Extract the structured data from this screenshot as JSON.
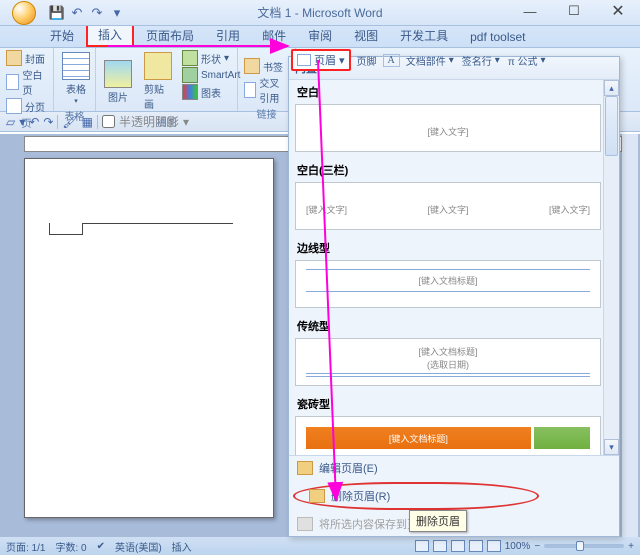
{
  "title": "文档 1 - Microsoft Word",
  "tabs": [
    "开始",
    "插入",
    "页面布局",
    "引用",
    "邮件",
    "审阅",
    "视图",
    "开发工具",
    "pdf toolset"
  ],
  "active_tab_index": 1,
  "ribbon": {
    "groups": [
      {
        "label": "页",
        "items": [
          "封面",
          "空白页",
          "分页"
        ]
      },
      {
        "label": "表格",
        "items": [
          "表格"
        ]
      },
      {
        "label": "插图",
        "items": [
          "图片",
          "剪贴画"
        ],
        "mini": [
          "形状",
          "SmartArt",
          "图表"
        ]
      },
      {
        "label": "链接",
        "mini": [
          "书签",
          "交叉引用"
        ]
      }
    ],
    "right_items": [
      "页眉",
      "页脚",
      "A",
      "文档部件",
      "签名行",
      "π 公式"
    ]
  },
  "header_button": "页眉",
  "qat2_label": "半透明阴影",
  "dropdown": {
    "title": "内置",
    "presets": [
      {
        "label": "空白",
        "placeholder": "[键入文字]"
      },
      {
        "label": "空白(三栏)",
        "cols": [
          "[键入文字]",
          "[键入文字]",
          "[键入文字]"
        ]
      },
      {
        "label": "边线型",
        "placeholder": "[键入文档标题]"
      },
      {
        "label": "传统型",
        "placeholder": "[键入文档标题]",
        "sub": "(选取日期)"
      },
      {
        "label": "瓷砖型",
        "placeholder": "[键入文档标题]"
      }
    ],
    "footer": {
      "edit": "编辑页眉(E)",
      "remove": "删除页眉(R)",
      "save": "将所选内容保存到页眉库",
      "tooltip": "删除页眉"
    }
  },
  "status": {
    "page": "页面: 1/1",
    "words": "字数: 0",
    "lang": "英语(美国)",
    "insert": "插入",
    "zoom": "100%"
  }
}
